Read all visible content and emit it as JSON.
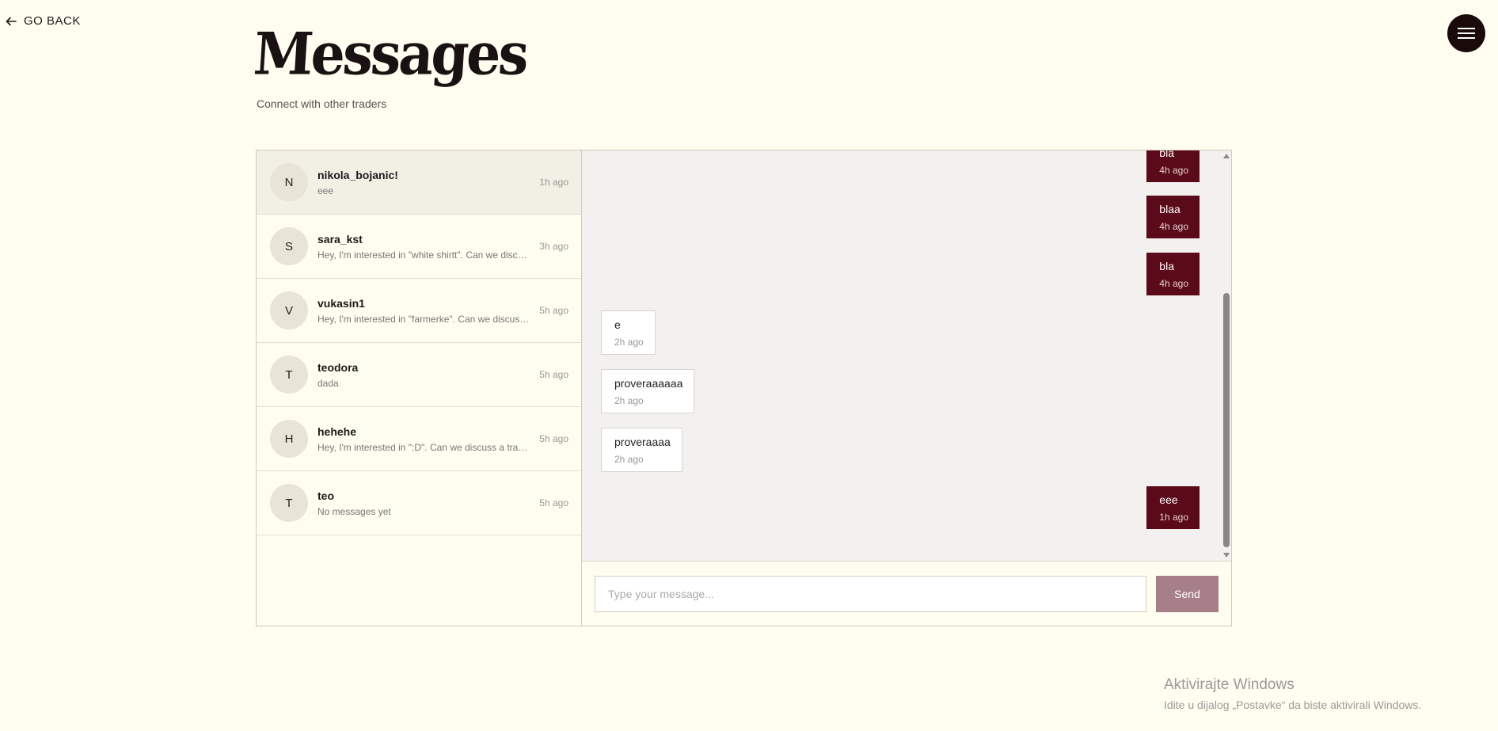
{
  "nav": {
    "go_back_label": "GO BACK",
    "back_icon": "arrow-left-icon",
    "menu_icon": "hamburger-menu-icon"
  },
  "header": {
    "title": "Messages",
    "subtitle": "Connect with other traders"
  },
  "conversations": [
    {
      "initial": "N",
      "name": "nikola_bojanic!",
      "preview": "eee",
      "time": "1h ago",
      "active": true
    },
    {
      "initial": "S",
      "name": "sara_kst",
      "preview": "Hey, I'm interested in \"white shirtt\". Can we discuss a trade?",
      "time": "3h ago"
    },
    {
      "initial": "V",
      "name": "vukasin1",
      "preview": "Hey, I'm interested in \"farmerke\". Can we discuss a trade?",
      "time": "5h ago"
    },
    {
      "initial": "T",
      "name": "teodora",
      "preview": "dada",
      "time": "5h ago"
    },
    {
      "initial": "H",
      "name": "hehehe",
      "preview": "Hey, I'm interested in \":D\". Can we discuss a trade?",
      "time": "5h ago"
    },
    {
      "initial": "T",
      "name": "teo",
      "preview": "No messages yet",
      "time": "5h ago"
    }
  ],
  "messages": [
    {
      "text": "bla",
      "time": "4h ago",
      "direction": "out"
    },
    {
      "text": "blaa",
      "time": "4h ago",
      "direction": "out"
    },
    {
      "text": "bla",
      "time": "4h ago",
      "direction": "out"
    },
    {
      "text": "e",
      "time": "2h ago",
      "direction": "in"
    },
    {
      "text": "proveraaaaaa",
      "time": "2h ago",
      "direction": "in"
    },
    {
      "text": "proveraaaa",
      "time": "2h ago",
      "direction": "in"
    },
    {
      "text": "eee",
      "time": "1h ago",
      "direction": "out"
    }
  ],
  "composer": {
    "placeholder": "Type your message...",
    "send_label": "Send"
  },
  "watermark": {
    "line1": "Aktivirajte Windows",
    "line2": "Idite u dijalog „Postavke“ da biste aktivirali Windows."
  },
  "colors": {
    "background": "#fffdf0",
    "outgoing_bubble": "#5a0a18",
    "send_button": "#a67f88",
    "menu_button": "#1a0a0a"
  }
}
